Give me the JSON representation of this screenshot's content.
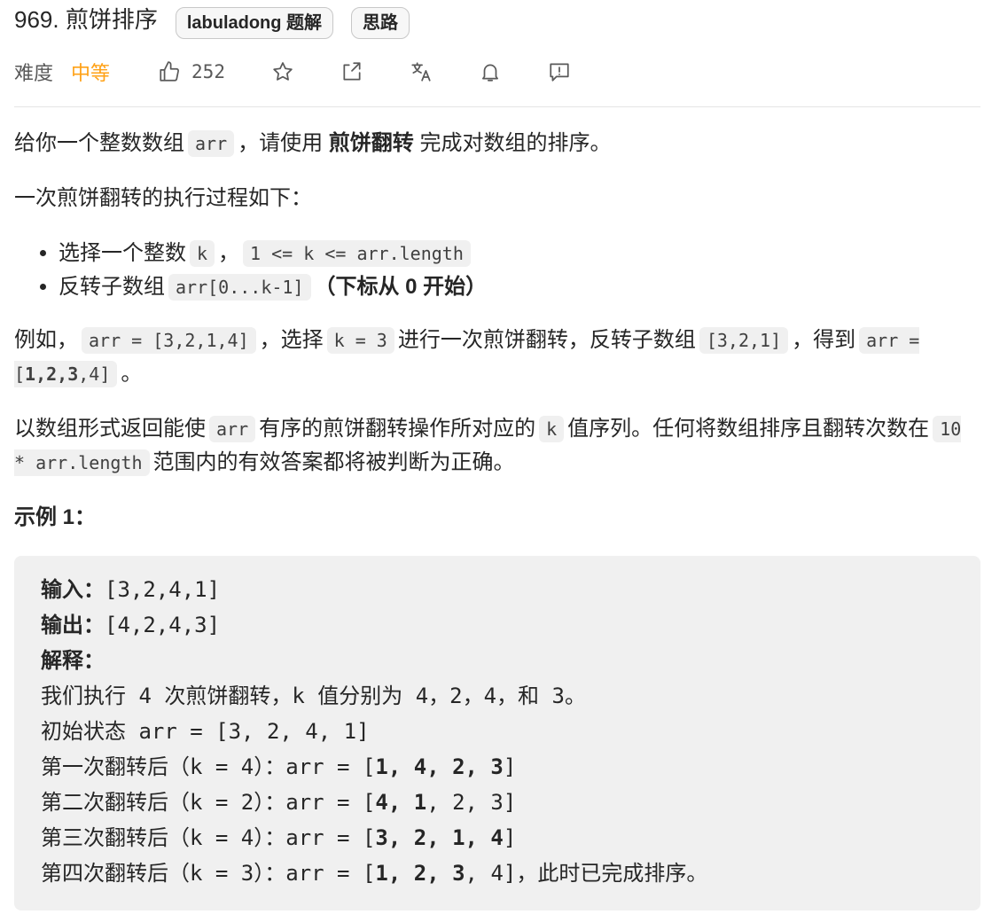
{
  "header": {
    "title": "969. 煎饼排序",
    "tags": [
      "labuladong 题解",
      "思路"
    ]
  },
  "meta": {
    "difficulty_label": "难度",
    "difficulty_value": "中等",
    "like_count": "252",
    "icons": [
      "thumbs-up-icon",
      "star-icon",
      "share-icon",
      "translate-icon",
      "bell-icon",
      "feedback-icon"
    ]
  },
  "description": {
    "p1": {
      "t1": "给你一个整数数组",
      "code1": "arr",
      "t2": "，请使用",
      "bold": "煎饼翻转",
      "t3": "完成对数组的排序。"
    },
    "p2": "一次煎饼翻转的执行过程如下：",
    "bullets": {
      "b1": {
        "t1": "选择一个整数",
        "code1": "k",
        "t2": "，",
        "code2": "1 <= k <= arr.length"
      },
      "b2": {
        "t1": "反转子数组",
        "code1": "arr[0...k-1]",
        "t2": "（下标从 0 开始）"
      }
    },
    "p3": {
      "t1": "例如，",
      "code1": "arr = [3,2,1,4]",
      "t2": "，选择",
      "code2": "k = 3",
      "t3": "进行一次煎饼翻转，反转子数组",
      "code3": "[3,2,1]",
      "t4": "，得到",
      "code4_pre": "arr = [",
      "code4_bold": "1,2,3",
      "code4_post": ",4]",
      "t5": "。"
    },
    "p4": {
      "t1": "以数组形式返回能使",
      "code1": "arr",
      "t2": "有序的煎饼翻转操作所对应的",
      "code2": "k",
      "t3": "值序列。任何将数组排序且翻转次数在",
      "code3": "10 * arr.length",
      "t4": "范围内的有效答案都将被判断为正确。"
    }
  },
  "example": {
    "title": "示例 1：",
    "input_label": "输入：",
    "input_value": "[3,2,4,1]",
    "output_label": "输出：",
    "output_value": "[4,2,4,3]",
    "explain_label": "解释：",
    "explain_line": "我们执行 4 次煎饼翻转，k 值分别为 4，2，4，和 3。",
    "init_line": "初始状态 arr = [3, 2, 4, 1]",
    "step1": {
      "pre": "第一次翻转后（k = 4）：arr = [",
      "bold": "1, 4, 2, 3",
      "post": "]"
    },
    "step2": {
      "pre": "第二次翻转后（k = 2）：arr = [",
      "bold": "4, 1",
      "post": ", 2, 3]"
    },
    "step3": {
      "pre": "第三次翻转后（k = 4）：arr = [",
      "bold": "3, 2, 1, 4",
      "post": "]"
    },
    "step4": {
      "pre": "第四次翻转后（k = 3）：arr = [",
      "bold": "1, 2, 3",
      "post": ", 4]，此时已完成排序。"
    }
  }
}
